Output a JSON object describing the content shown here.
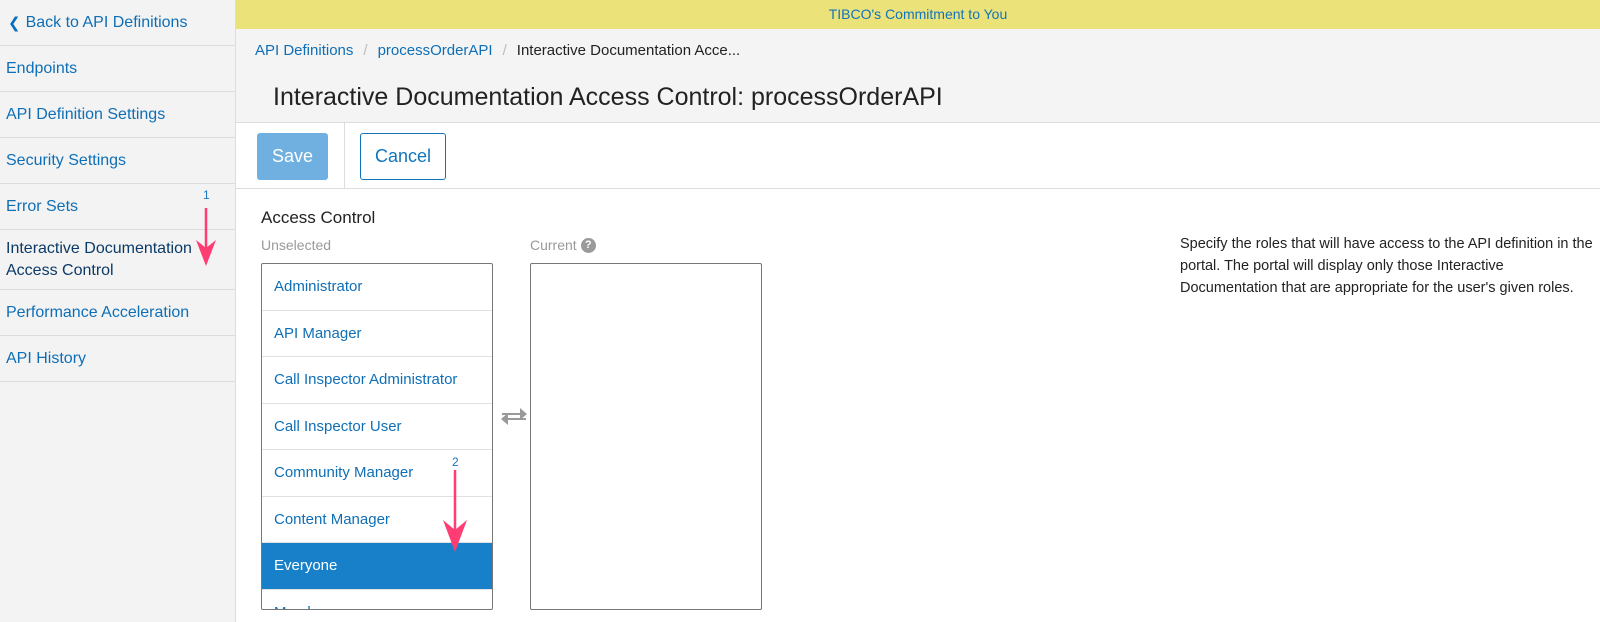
{
  "sidebar": {
    "back_label": "Back to API Definitions",
    "items": [
      {
        "label": "Endpoints"
      },
      {
        "label": "API Definition Settings"
      },
      {
        "label": "Security Settings"
      },
      {
        "label": "Error Sets"
      },
      {
        "label": "Interactive Documentation Access Control"
      },
      {
        "label": "Performance Acceleration"
      },
      {
        "label": "API History"
      }
    ]
  },
  "banner": {
    "text": "TIBCO's Commitment to You"
  },
  "breadcrumb": {
    "items": [
      "API Definitions",
      "processOrderAPI",
      "Interactive Documentation Acce..."
    ]
  },
  "page": {
    "title": "Interactive Documentation Access Control: processOrderAPI"
  },
  "toolbar": {
    "save_label": "Save",
    "cancel_label": "Cancel"
  },
  "access_control": {
    "section_title": "Access Control",
    "unselected_label": "Unselected",
    "current_label": "Current",
    "unselected_items": [
      "Administrator",
      "API Manager",
      "Call Inspector Administrator",
      "Call Inspector User",
      "Community Manager",
      "Content Manager",
      "Everyone",
      "Member"
    ],
    "selected_item": "Everyone",
    "help_text": "Specify the roles that will have access to the API definition in the portal. The portal will display only those Interactive Documentation that are appropriate for the user's given roles."
  },
  "annotations": {
    "marker_1": "1",
    "marker_2": "2",
    "arrow_color": "#ff3d73"
  },
  "colors": {
    "link": "#0f6fb6",
    "banner_bg": "#ece27a",
    "selected_bg": "#1780c9",
    "save_bg": "#6fb0e0"
  }
}
